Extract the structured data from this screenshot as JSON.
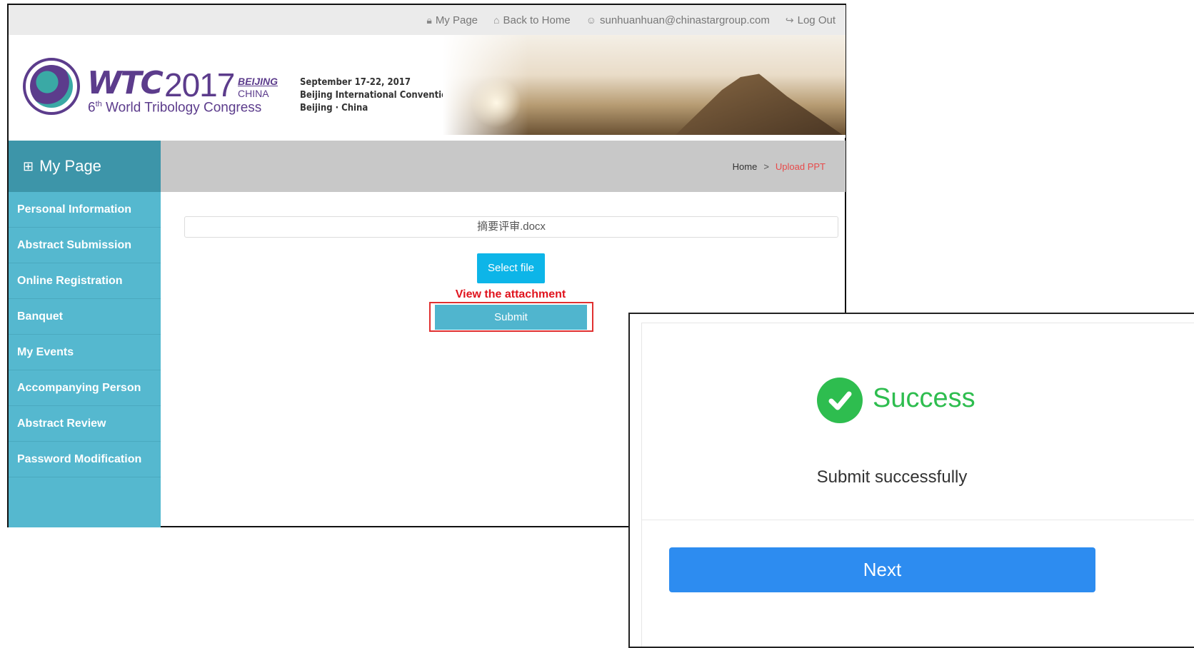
{
  "topbar": {
    "links": [
      {
        "icon": "lock-icon",
        "label": "My Page"
      },
      {
        "icon": "home-icon",
        "label": "Back to Home"
      },
      {
        "icon": "user-icon",
        "label": "sunhuanhuan@chinastargroup.com"
      },
      {
        "icon": "logout-icon",
        "label": "Log Out"
      }
    ]
  },
  "banner": {
    "logo_wtc": "WTC",
    "logo_year": "2017",
    "logo_beijing": "BEIJING",
    "logo_china": "CHINA",
    "logo_ordinal": "6",
    "logo_ordinal_suffix": "th",
    "logo_subtitle": " World Tribology Congress",
    "date": "September 17-22, 2017",
    "venue": "Beijing International Convention Center",
    "location": "Beijing · China"
  },
  "sidebar": {
    "title": "My Page",
    "items": [
      {
        "label": "Personal Information"
      },
      {
        "label": "Abstract Submission"
      },
      {
        "label": "Online Registration"
      },
      {
        "label": "Banquet"
      },
      {
        "label": "My Events"
      },
      {
        "label": "Accompanying Person"
      },
      {
        "label": "Abstract Review"
      },
      {
        "label": "Password Modification"
      }
    ]
  },
  "breadcrumb": {
    "home": "Home",
    "separator": ">",
    "current": "Upload PPT"
  },
  "upload": {
    "file_name": "摘要评审.docx",
    "select_label": "Select file",
    "annotation": "View the attachment",
    "submit_label": "Submit"
  },
  "modal": {
    "title": "Success",
    "message": "Submit successfully",
    "next_label": "Next"
  },
  "colors": {
    "accent": "#55b8cf",
    "sidebar_header": "#3d95a9",
    "success": "#2ebd4f",
    "next_button": "#2d8cf0",
    "annotation_red": "#e0141e"
  }
}
